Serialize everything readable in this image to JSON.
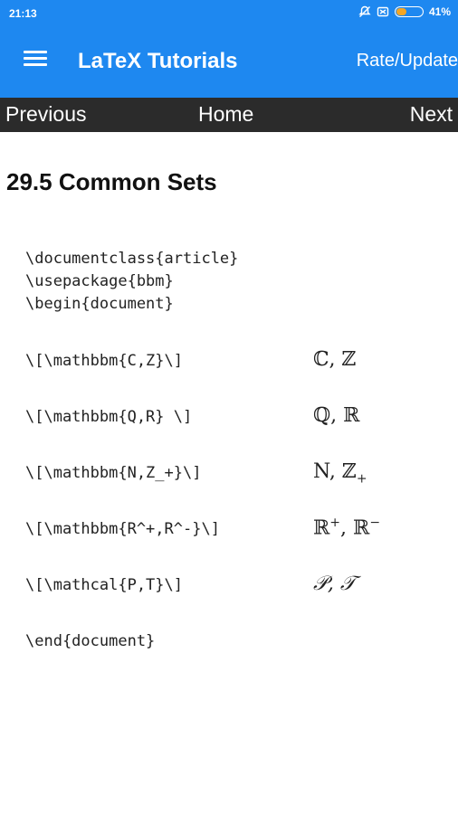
{
  "status_bar": {
    "time": "21:13",
    "battery_percent": "41%",
    "battery_level": 0.41,
    "icons": [
      "muted-bell-icon",
      "sim-off-icon",
      "battery-icon"
    ]
  },
  "toolbar": {
    "title": "LaTeX Tutorials",
    "rate_label": "Rate/Update",
    "menu_icon": "hamburger-menu-icon",
    "color": "#1e88f0"
  },
  "nav": {
    "previous": "Previous",
    "home": "Home",
    "next": "Next",
    "color": "#2b2b2b"
  },
  "page": {
    "heading": "29.5 Common Sets",
    "preamble": [
      "\\documentclass{article}",
      "\\usepackage{bbm}",
      "\\begin{document}"
    ],
    "examples": [
      {
        "code": "\\[\\mathbbm{C,Z}\\]",
        "output": "ℂ, ℤ"
      },
      {
        "code": "\\[\\mathbbm{Q,R} \\]",
        "output": "ℚ, ℝ"
      },
      {
        "code": "\\[\\mathbbm{N,Z_+}\\]",
        "output_main": "N, ℤ",
        "output_sub": "+"
      },
      {
        "code": "\\[\\mathbbm{R^+,R^-}\\]",
        "output_r1": "ℝ",
        "output_sup1": "+",
        "output_mid": ", ℝ",
        "output_sup2": "−"
      },
      {
        "code": "\\[\\mathcal{P,T}\\]",
        "output": "𝒫, 𝒯"
      }
    ],
    "end": "\\end{document}"
  }
}
